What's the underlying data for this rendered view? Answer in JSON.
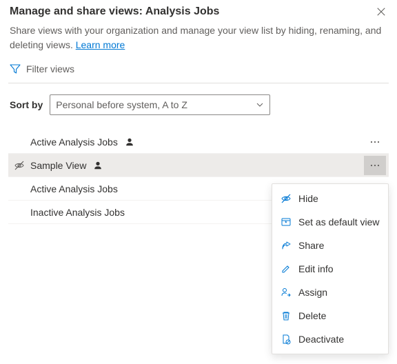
{
  "header": {
    "title": "Manage and share views: Analysis Jobs"
  },
  "description": {
    "text": "Share views with your organization and manage your view list by hiding, renaming, and deleting views. ",
    "link_text": "Learn more"
  },
  "filter": {
    "label": "Filter views"
  },
  "sort": {
    "label": "Sort by",
    "selected": "Personal before system, A to Z"
  },
  "views": [
    {
      "name": "Active Analysis Jobs",
      "personal": true,
      "hidden": false,
      "selected": false,
      "show_more": true
    },
    {
      "name": "Sample View",
      "personal": true,
      "hidden": true,
      "selected": true,
      "show_more": true
    },
    {
      "name": "Active Analysis Jobs",
      "personal": false,
      "hidden": false,
      "selected": false,
      "show_more": false
    },
    {
      "name": "Inactive Analysis Jobs",
      "personal": false,
      "hidden": false,
      "selected": false,
      "show_more": false
    }
  ],
  "context_menu": {
    "items": [
      {
        "icon": "eye-off",
        "label": "Hide"
      },
      {
        "icon": "default-view",
        "label": "Set as default view"
      },
      {
        "icon": "share",
        "label": "Share"
      },
      {
        "icon": "edit",
        "label": "Edit info"
      },
      {
        "icon": "assign",
        "label": "Assign"
      },
      {
        "icon": "delete",
        "label": "Delete"
      },
      {
        "icon": "deactivate",
        "label": "Deactivate"
      }
    ]
  }
}
